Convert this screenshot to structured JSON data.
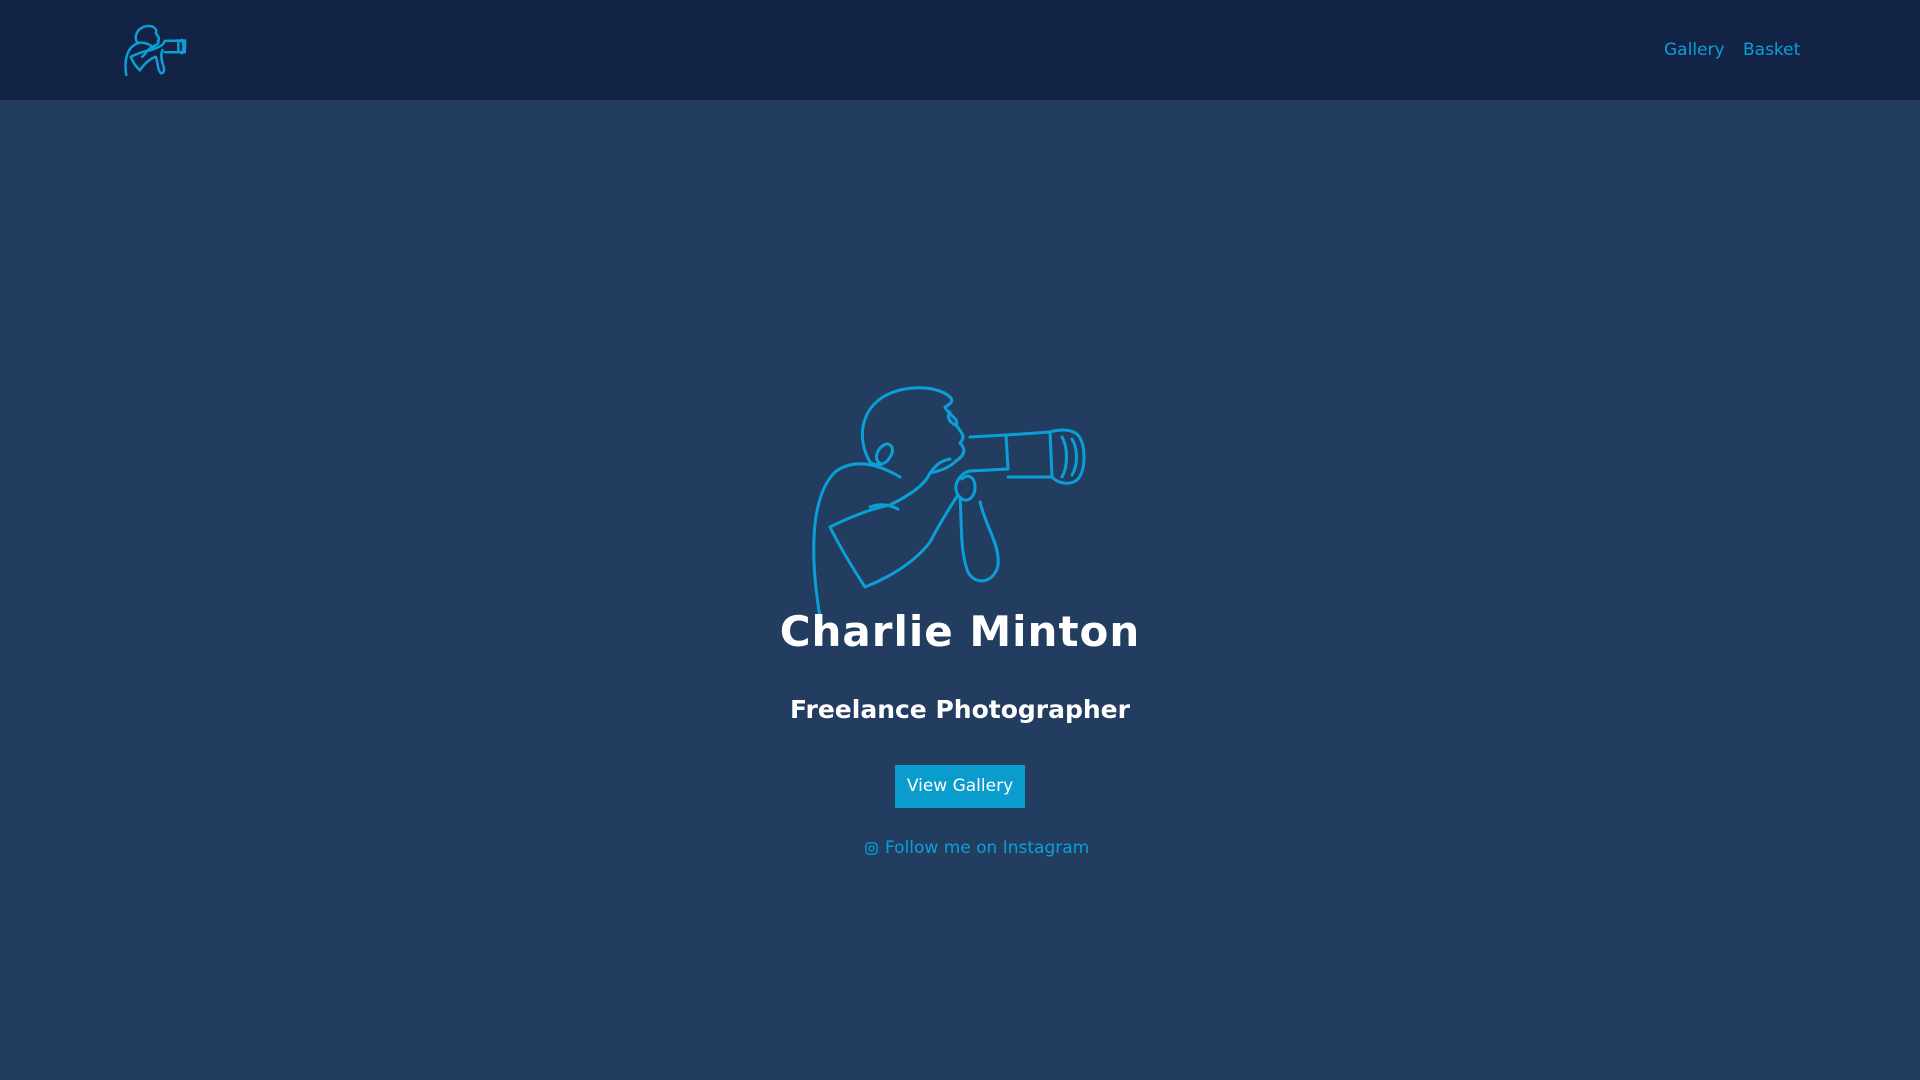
{
  "colors": {
    "navbar_bg": "#132345",
    "page_bg": "#233d61",
    "accent": "#0aa0d6",
    "button_bg": "#0a9ccc",
    "heading_text": "#ffffff"
  },
  "header": {
    "logo_icon": "photographer-line-art-icon",
    "nav": {
      "gallery_label": "Gallery",
      "basket_label": "Basket"
    }
  },
  "hero": {
    "illustration_icon": "photographer-line-art-icon",
    "name": "Charlie Minton",
    "role": "Freelance Photographer",
    "cta_label": "View Gallery",
    "instagram_icon": "instagram-icon",
    "instagram_label": "Follow me on Instagram"
  }
}
